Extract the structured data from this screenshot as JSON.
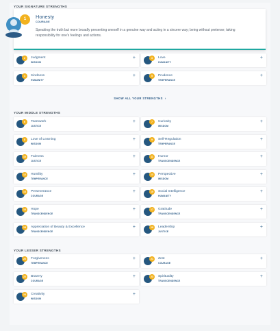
{
  "signature": {
    "heading": "YOUR SIGNATURE STRENGTHS",
    "hero": {
      "rank": "1",
      "name": "Honesty",
      "virtue": "COURAGE",
      "description": "Speaking the truth but more broadly presenting oneself in a genuine way and acting in a sincere way; being without pretense; taking responsibility for one's feelings and actions."
    },
    "items": [
      {
        "rank": "2",
        "name": "Judgment",
        "virtue": "WISDOM"
      },
      {
        "rank": "3",
        "name": "Love",
        "virtue": "HUMANITY"
      },
      {
        "rank": "4",
        "name": "Kindness",
        "virtue": "HUMANITY"
      },
      {
        "rank": "5",
        "name": "Prudence",
        "virtue": "TEMPERANCE"
      }
    ],
    "show_all": "SHOW ALL YOUR STRENGTHS"
  },
  "middle": {
    "heading": "YOUR MIDDLE STRENGTHS",
    "items": [
      {
        "rank": "6",
        "name": "Teamwork",
        "virtue": "JUSTICE"
      },
      {
        "rank": "7",
        "name": "Curiosity",
        "virtue": "WISDOM"
      },
      {
        "rank": "8",
        "name": "Love of Learning",
        "virtue": "WISDOM"
      },
      {
        "rank": "9",
        "name": "Self-Regulation",
        "virtue": "TEMPERANCE"
      },
      {
        "rank": "10",
        "name": "Fairness",
        "virtue": "JUSTICE"
      },
      {
        "rank": "11",
        "name": "Humor",
        "virtue": "TRANSCENDENCE"
      },
      {
        "rank": "12",
        "name": "Humility",
        "virtue": "TEMPERANCE"
      },
      {
        "rank": "13",
        "name": "Perspective",
        "virtue": "WISDOM"
      },
      {
        "rank": "14",
        "name": "Perseverance",
        "virtue": "COURAGE"
      },
      {
        "rank": "15",
        "name": "Social Intelligence",
        "virtue": "HUMANITY"
      },
      {
        "rank": "16",
        "name": "Hope",
        "virtue": "TRANSCENDENCE"
      },
      {
        "rank": "17",
        "name": "Gratitude",
        "virtue": "TRANSCENDENCE"
      },
      {
        "rank": "18",
        "name": "Appreciation of Beauty & Excellence",
        "virtue": "TRANSCENDENCE"
      },
      {
        "rank": "19",
        "name": "Leadership",
        "virtue": "JUSTICE"
      }
    ]
  },
  "lesser": {
    "heading": "YOUR LESSER STRENGTHS",
    "items": [
      {
        "rank": "20",
        "name": "Forgiveness",
        "virtue": "TEMPERANCE"
      },
      {
        "rank": "21",
        "name": "Zest",
        "virtue": "COURAGE"
      },
      {
        "rank": "22",
        "name": "Bravery",
        "virtue": "COURAGE"
      },
      {
        "rank": "23",
        "name": "Spirituality",
        "virtue": "TRANSCENDENCE"
      },
      {
        "rank": "24",
        "name": "Creativity",
        "virtue": "WISDOM"
      }
    ]
  },
  "expand_glyph": "+",
  "colors": {
    "accent": "#1fa8a1",
    "badge": "#f2b21f",
    "text": "#2b5a86",
    "icon": "#25577f"
  }
}
